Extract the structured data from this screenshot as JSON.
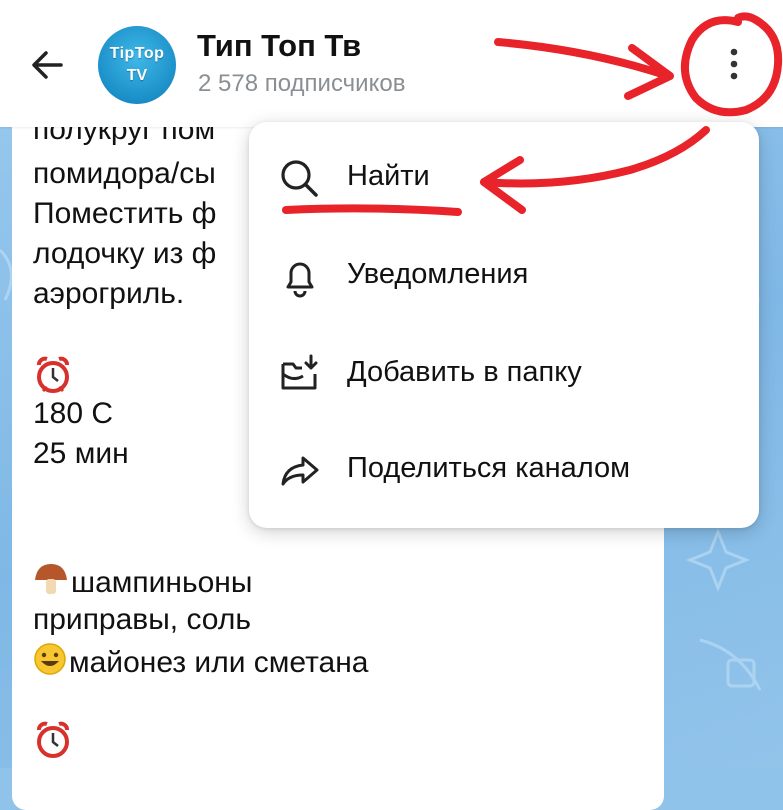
{
  "header": {
    "title": "Тип Топ Тв",
    "subscribers": "2 578 подписчиков",
    "avatar": {
      "line1": "TipTop",
      "line2": "TV"
    },
    "back_icon": "arrow-left-icon",
    "more_icon": "more-vertical-icon"
  },
  "message": {
    "lines": [
      "полукруг пом",
      "помидора/сы",
      "Поместить ф",
      "лодочку из ф",
      "аэрогриль.",
      "180 С",
      "25 мин",
      "шампиньоны",
      "приправы, соль",
      "майонез или сметана"
    ],
    "icons": [
      "alarm-clock-icon",
      "mushroom-icon",
      "smiley-icon"
    ]
  },
  "menu": {
    "items": [
      {
        "label": "Найти",
        "icon": "search-icon"
      },
      {
        "label": "Уведомления",
        "icon": "bell-icon"
      },
      {
        "label": "Добавить в папку",
        "icon": "folder-add-icon"
      },
      {
        "label": "Поделиться каналом",
        "icon": "share-icon"
      }
    ]
  },
  "colors": {
    "annotation": "#e8232a",
    "chat_background": "#8fc3ea",
    "accent": "#1b8fc8",
    "subtitle": "#8a8f94"
  }
}
